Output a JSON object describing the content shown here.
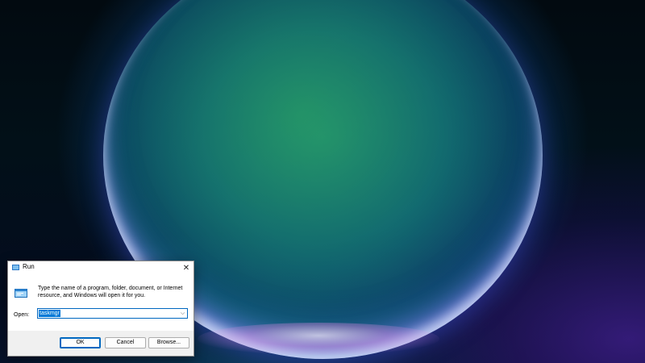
{
  "dialog": {
    "title": "Run",
    "close_glyph": "✕",
    "description": "Type the name of a program, folder, document, or Internet resource, and Windows will open it for you.",
    "open_label": "Open:",
    "open_value": "taskmgr",
    "dropdown_glyph": "⌵",
    "buttons": {
      "ok": "OK",
      "cancel": "Cancel",
      "browse": "Browse..."
    },
    "icons": {
      "title": "run-icon",
      "body": "run-program-icon",
      "close": "close-icon",
      "dropdown": "chevron-down-icon"
    }
  },
  "colors": {
    "accent": "#0067c0",
    "selection": "#0078d7",
    "dialog_bg": "#f0f0f0"
  }
}
